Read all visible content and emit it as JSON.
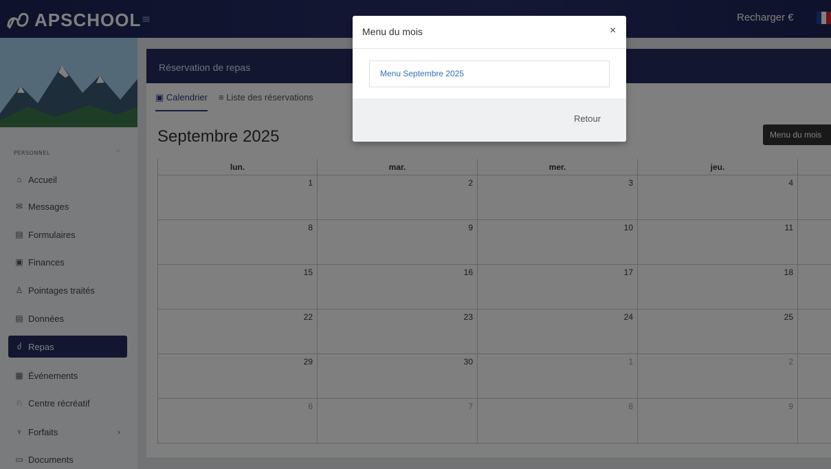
{
  "header": {
    "logo_text": "APSCHOOL",
    "recharge_label": "Recharger €",
    "menu_icon": "hamburger-icon",
    "flag_colors": [
      "#1f3fa0",
      "#ffffff",
      "#e0202f"
    ]
  },
  "sidebar": {
    "section_label": "PERSONNEL",
    "items": [
      {
        "label": "Accueil",
        "icon": "home-icon",
        "glyph": "⌂"
      },
      {
        "label": "Messages",
        "icon": "mail-icon",
        "glyph": "✉"
      },
      {
        "label": "Formulaires",
        "icon": "form-icon",
        "glyph": "▤"
      },
      {
        "label": "Finances",
        "icon": "finance-icon",
        "glyph": "▣"
      },
      {
        "label": "Pointages traités",
        "icon": "people-icon",
        "glyph": "♙"
      },
      {
        "label": "Données",
        "icon": "data-icon",
        "glyph": "▤"
      },
      {
        "label": "Repas",
        "icon": "meal-icon",
        "glyph": "ძ",
        "active": true
      },
      {
        "label": "Événements",
        "icon": "calendar-event-icon",
        "glyph": "▦"
      },
      {
        "label": "Centre récréatif",
        "icon": "user-icon",
        "glyph": "♘"
      },
      {
        "label": "Forfaits",
        "icon": "package-icon",
        "glyph": "♆"
      },
      {
        "label": "Documents",
        "icon": "folder-icon",
        "glyph": "▭"
      }
    ]
  },
  "main": {
    "card_title": "Réservation de repas",
    "tabs": [
      {
        "label": "Calendrier",
        "icon": "calendar-icon",
        "glyph": "▣"
      },
      {
        "label": "Liste des réservations",
        "icon": "list-icon",
        "glyph": "≡"
      }
    ],
    "month_title": "Septembre 2025",
    "menu_button": "Menu du mois",
    "calendar": {
      "days": [
        "lun.",
        "mar.",
        "mer.",
        "jeu.",
        ""
      ],
      "weeks": [
        [
          {
            "d": "1"
          },
          {
            "d": "2"
          },
          {
            "d": "3"
          },
          {
            "d": "4"
          },
          {
            "d": ""
          }
        ],
        [
          {
            "d": "8"
          },
          {
            "d": "9"
          },
          {
            "d": "10"
          },
          {
            "d": "11"
          },
          {
            "d": ""
          }
        ],
        [
          {
            "d": "15"
          },
          {
            "d": "16"
          },
          {
            "d": "17"
          },
          {
            "d": "18"
          },
          {
            "d": ""
          }
        ],
        [
          {
            "d": "22"
          },
          {
            "d": "23"
          },
          {
            "d": "24"
          },
          {
            "d": "25"
          },
          {
            "d": ""
          }
        ],
        [
          {
            "d": "29"
          },
          {
            "d": "30"
          },
          {
            "d": "1",
            "other": true
          },
          {
            "d": "2",
            "other": true
          },
          {
            "d": ""
          }
        ],
        [
          {
            "d": "6",
            "other": true
          },
          {
            "d": "7",
            "other": true
          },
          {
            "d": "8",
            "other": true
          },
          {
            "d": "9",
            "other": true
          },
          {
            "d": ""
          }
        ]
      ]
    }
  },
  "modal": {
    "title": "Menu du mois",
    "close": "×",
    "menu_link": "Menu Septembre 2025",
    "back_button": "Retour"
  },
  "colors": {
    "primary": "#242d63",
    "link": "#2f72b7"
  }
}
